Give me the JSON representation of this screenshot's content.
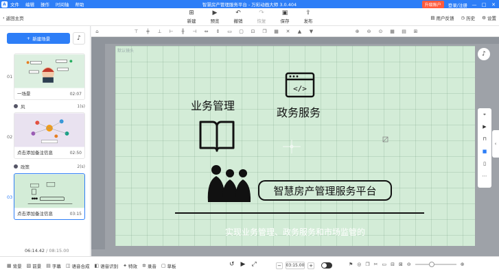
{
  "window": {
    "title": "智慧房产管理服务平台 - 万彩动画大师 3.0.404",
    "menu": [
      "文件",
      "编辑",
      "操作",
      "时间轴",
      "帮助"
    ],
    "vip_label": "升级账户",
    "login_label": "登录/注册",
    "controls": [
      "—",
      "□",
      "✕"
    ]
  },
  "toolbar": {
    "home_label": "返回主页",
    "buttons": [
      {
        "label": "新建",
        "icon": "plus-square-icon",
        "enabled": true
      },
      {
        "label": "预览",
        "icon": "play-icon",
        "enabled": true
      },
      {
        "label": "撤销",
        "icon": "undo-icon",
        "enabled": true
      },
      {
        "label": "恢复",
        "icon": "redo-icon",
        "enabled": false
      },
      {
        "label": "保存",
        "icon": "save-icon",
        "enabled": true
      },
      {
        "label": "发布",
        "icon": "publish-icon",
        "enabled": true
      }
    ],
    "right": [
      {
        "label": "用户反馈",
        "icon": "feedback-icon"
      },
      {
        "label": "历史",
        "icon": "history-icon"
      },
      {
        "label": "设置",
        "icon": "gear-icon"
      }
    ]
  },
  "scenes_panel": {
    "new_scene_label": "新建场景",
    "scenes": [
      {
        "number": "01",
        "caption": "一场景",
        "duration": "02:07",
        "transition": {
          "name": "风",
          "duration": "1(s)"
        }
      },
      {
        "number": "02",
        "caption": "点击添加备注信息",
        "duration": "02:50",
        "transition": {
          "name": "政策",
          "duration": "2(s)"
        }
      },
      {
        "number": "03",
        "caption": "点击添加备注信息",
        "duration": "03:15",
        "active": true
      }
    ],
    "current_time": "06:14.42",
    "total_time": "/ 08:15.00"
  },
  "canvas": {
    "camera_label": "默认镜头",
    "title_business": "业务管理",
    "title_government": "政务服务",
    "banner_text": "智慧房产管理服务平台",
    "subtitle": "实现业务管理、政务服务和市场监管的"
  },
  "bottom_bar": {
    "tools": [
      {
        "label": "背景",
        "icon": "background-icon"
      },
      {
        "label": "前景",
        "icon": "foreground-icon"
      },
      {
        "label": "字幕",
        "icon": "subtitle-icon"
      },
      {
        "label": "语音合成",
        "icon": "tts-icon"
      },
      {
        "label": "语音识别",
        "icon": "asr-icon"
      },
      {
        "label": "特效",
        "icon": "effects-icon"
      },
      {
        "label": "录音",
        "icon": "record-icon"
      },
      {
        "label": "草板",
        "icon": "board-icon"
      }
    ],
    "time_value": "03:15.00"
  }
}
